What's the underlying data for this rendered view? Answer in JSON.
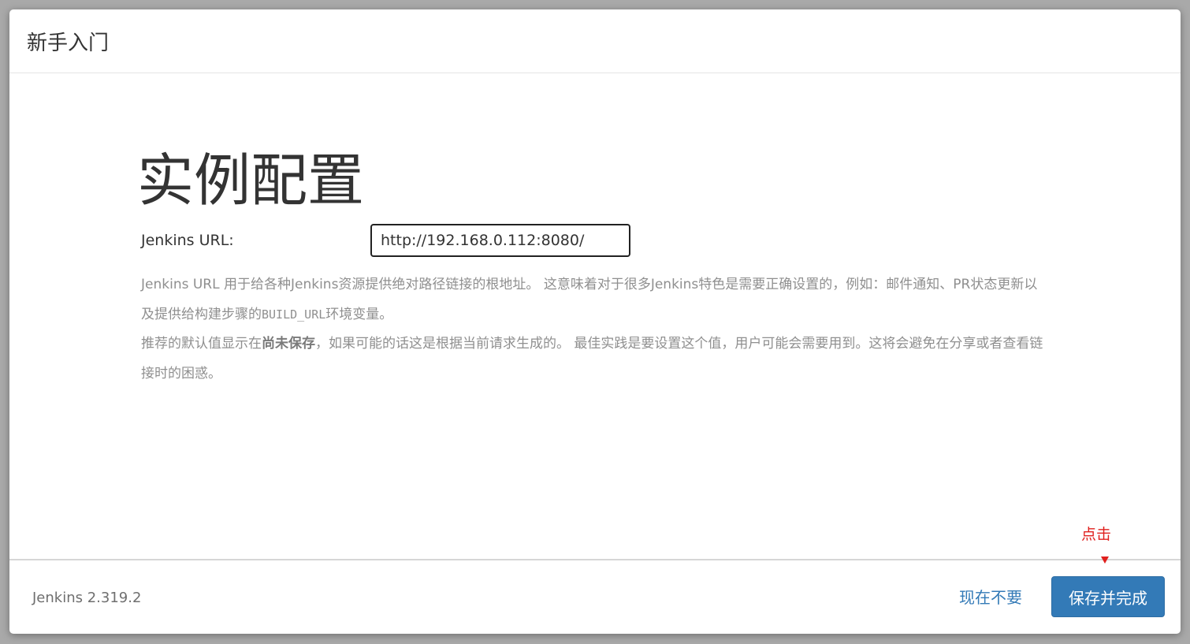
{
  "header": {
    "title": "新手入门"
  },
  "main": {
    "heading": "实例配置",
    "url_label": "Jenkins URL:",
    "url_value": "http://192.168.0.112:8080/",
    "help": {
      "p1_start": "Jenkins URL 用于给各种Jenkins资源提供绝对路径链接的根地址。 这意味着对于很多Jenkins特色是需要正确设置的，例如：邮件通知、PR状态更新以及提供给构建步骤的",
      "p1_code": "BUILD_URL",
      "p1_end": "环境变量。",
      "p2_start": "推荐的默认值显示在",
      "p2_bold": "尚未保存",
      "p2_end": "，如果可能的话这是根据当前请求生成的。 最佳实践是要设置这个值，用户可能会需要用到。这将会避免在分享或者查看链接时的困惑。"
    }
  },
  "footer": {
    "version": "Jenkins 2.319.2",
    "skip_label": "现在不要",
    "save_label": "保存并完成"
  },
  "annotation": {
    "text": "点击",
    "color": "#e0201e"
  },
  "colors": {
    "primary": "#337ab7",
    "link": "#337ab7"
  }
}
